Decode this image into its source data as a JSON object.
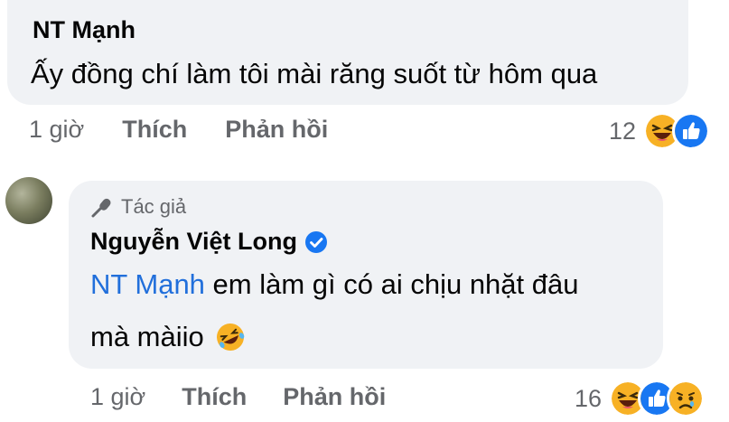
{
  "comments": [
    {
      "author": "NT Mạnh",
      "text": "Ấy đồng chí làm tôi mài răng suốt từ hôm qua",
      "time": "1 giờ",
      "like_label": "Thích",
      "reply_label": "Phản hồi",
      "reaction_count": "12",
      "reaction_icons": [
        "haha-icon",
        "like-icon"
      ]
    },
    {
      "badge": "Tác giả",
      "author": "Nguyễn Việt Long",
      "verified_icon": "verified-check-icon",
      "mention": "NT Mạnh",
      "text_line1": " em làm gì có ai chịu nhặt đâu",
      "text_line2": "mà màiio",
      "inline_emoji": "rolling-on-floor-laughing-icon",
      "time": "1 giờ",
      "like_label": "Thích",
      "reply_label": "Phản hồi",
      "reaction_count": "16",
      "reaction_icons": [
        "haha-icon",
        "like-icon",
        "sad-icon"
      ]
    }
  ],
  "colors": {
    "bubble": "#f0f2f5",
    "secondary_text": "#65676b",
    "mention": "#216fdb",
    "like_blue": "#1877f2",
    "emoji_yellow": "#f7b125"
  }
}
